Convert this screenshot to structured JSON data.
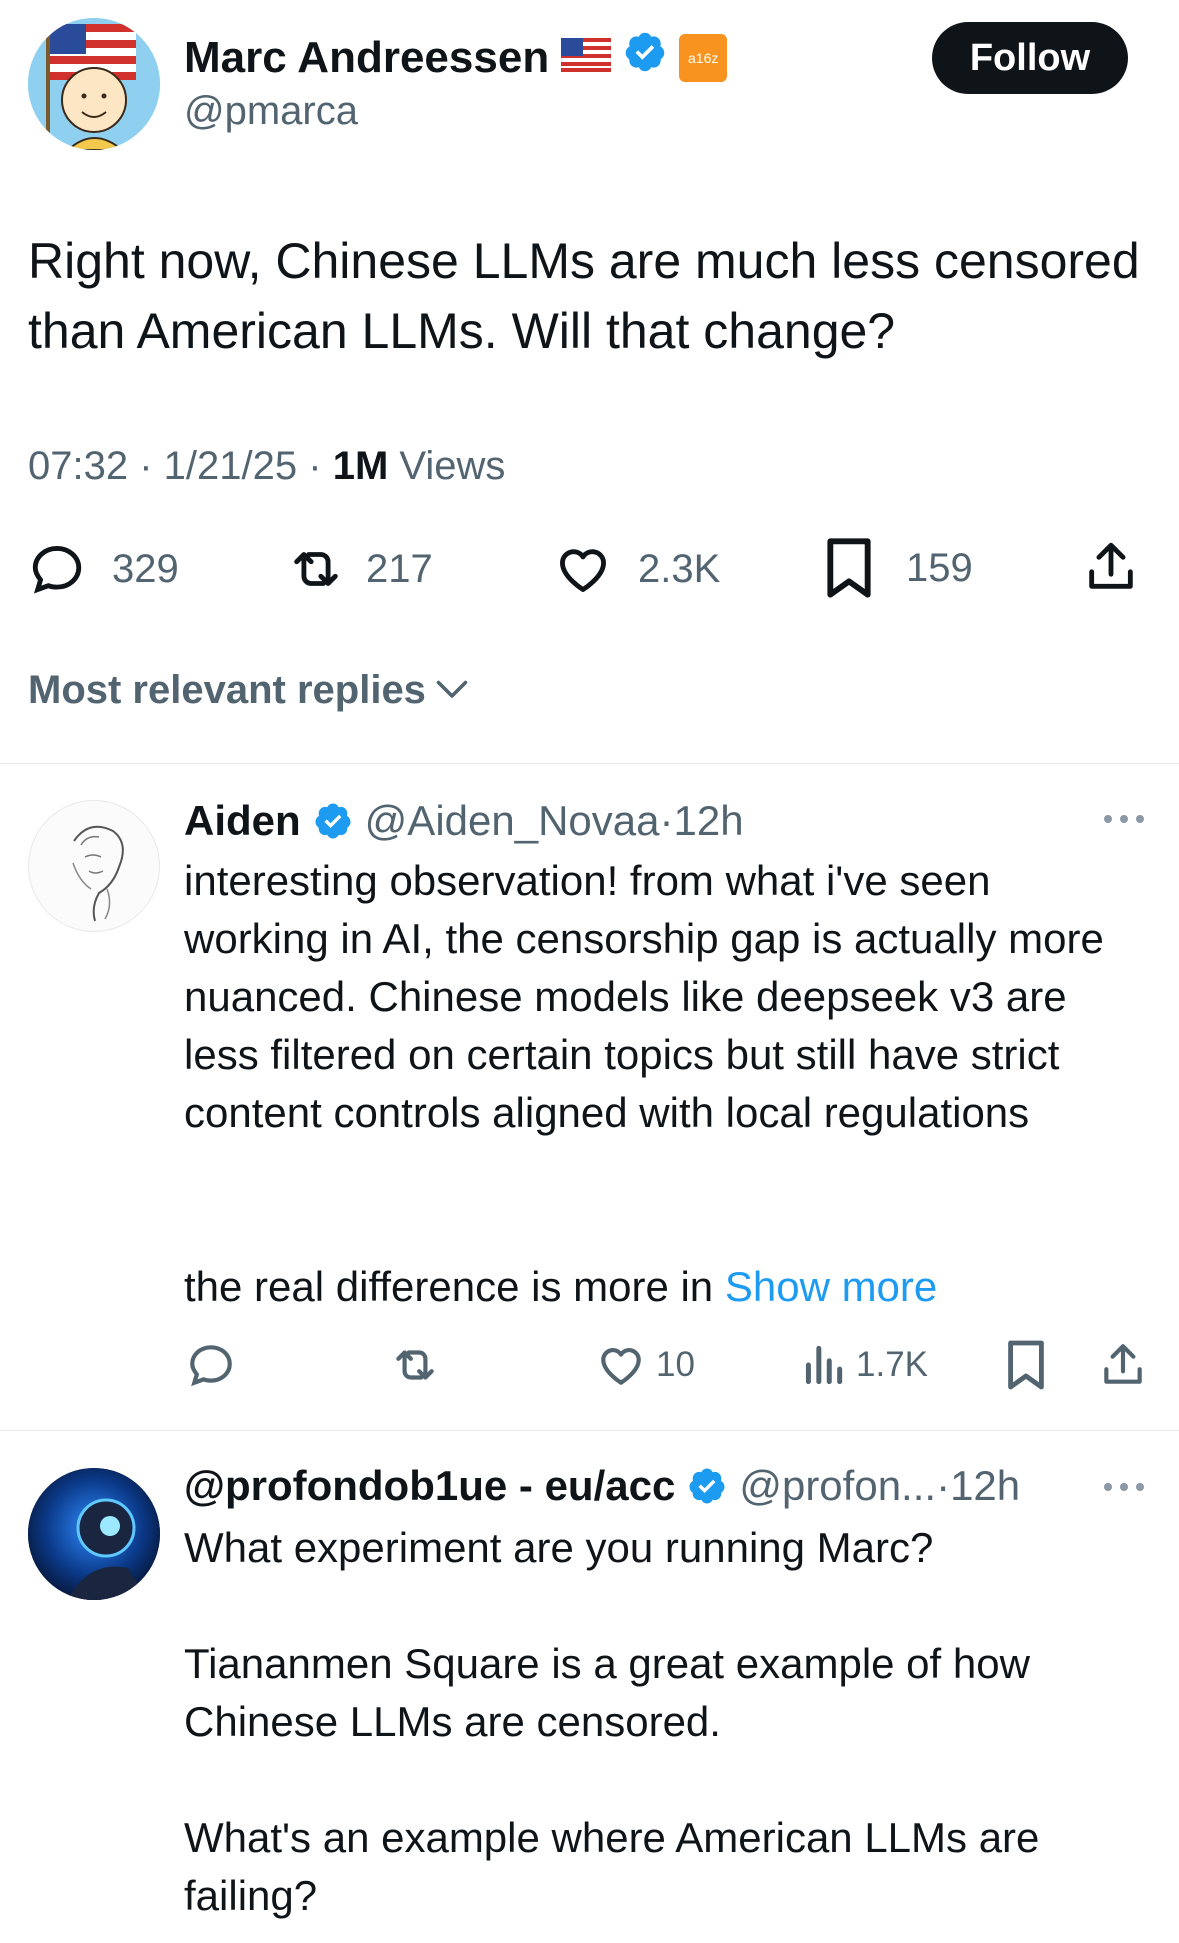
{
  "tweet": {
    "author_name": "Marc Andreessen",
    "handle": "@pmarca",
    "badge_text": "a16z",
    "follow_label": "Follow",
    "text": "Right now, Chinese LLMs are much less censored than American LLMs. Will that change?",
    "time": "07:32",
    "date": "1/21/25",
    "views_count": "1M",
    "views_label": "Views",
    "replies": "329",
    "reposts": "217",
    "likes": "2.3K",
    "bookmarks": "159"
  },
  "sort": {
    "label": "Most relevant replies"
  },
  "replies": [
    {
      "name": "Aiden",
      "handle": "@Aiden_Novaa",
      "time": "12h",
      "text_p1": "interesting observation! from what i've seen working in AI, the censorship gap is actually more nuanced. Chinese models like deepseek v3 are less filtered on certain topics but still have strict content controls aligned with local regulations",
      "text_p2": "the real difference is more in",
      "show_more": "Show more",
      "likes": "10",
      "views": "1.7K"
    },
    {
      "name": "@profondob1ue - eu/acc",
      "handle": "@profon...",
      "time": "12h",
      "text_p1": "What experiment are you running Marc?",
      "text_p2": "Tiananmen Square is a great example of how Chinese LLMs are censored.",
      "text_p3": "What's an example where American LLMs are failing?"
    }
  ],
  "colors": {
    "verified": "#1d9bf0",
    "link": "#1d9bf0",
    "text": "#0f1419",
    "muted": "#536471",
    "a16z": "#f7931e"
  }
}
